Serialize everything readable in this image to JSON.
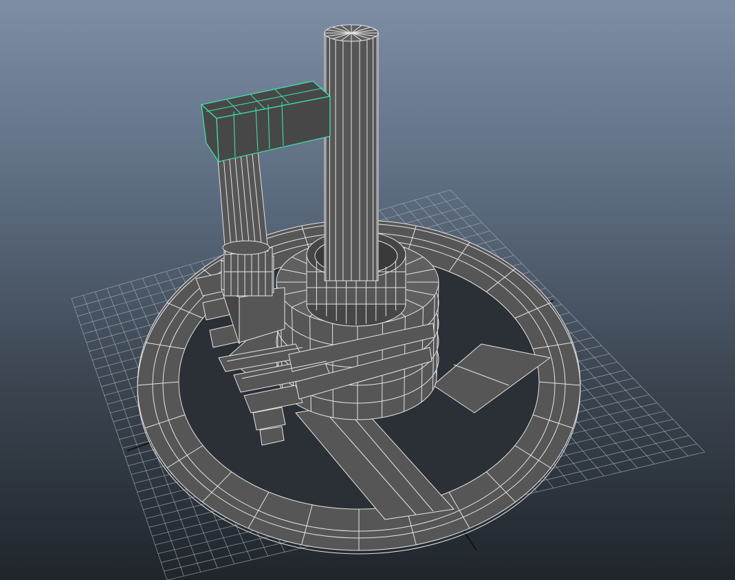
{
  "viewport": {
    "view": "perspective",
    "background_top": "#7d8ea5",
    "background_bottom": "#20252b"
  },
  "scene": {
    "grid": true,
    "grid_color": "#a9adb2",
    "axis_color": "#101214",
    "wireframe_color": "#e6e6e6",
    "mesh_color": "#565656",
    "selection_color": "#3ee0a8",
    "objects": [
      "base-ring",
      "spokes",
      "spiral-stairs",
      "tall-pillar",
      "short-pillar",
      "crossbeam"
    ],
    "selected": "crossbeam"
  }
}
